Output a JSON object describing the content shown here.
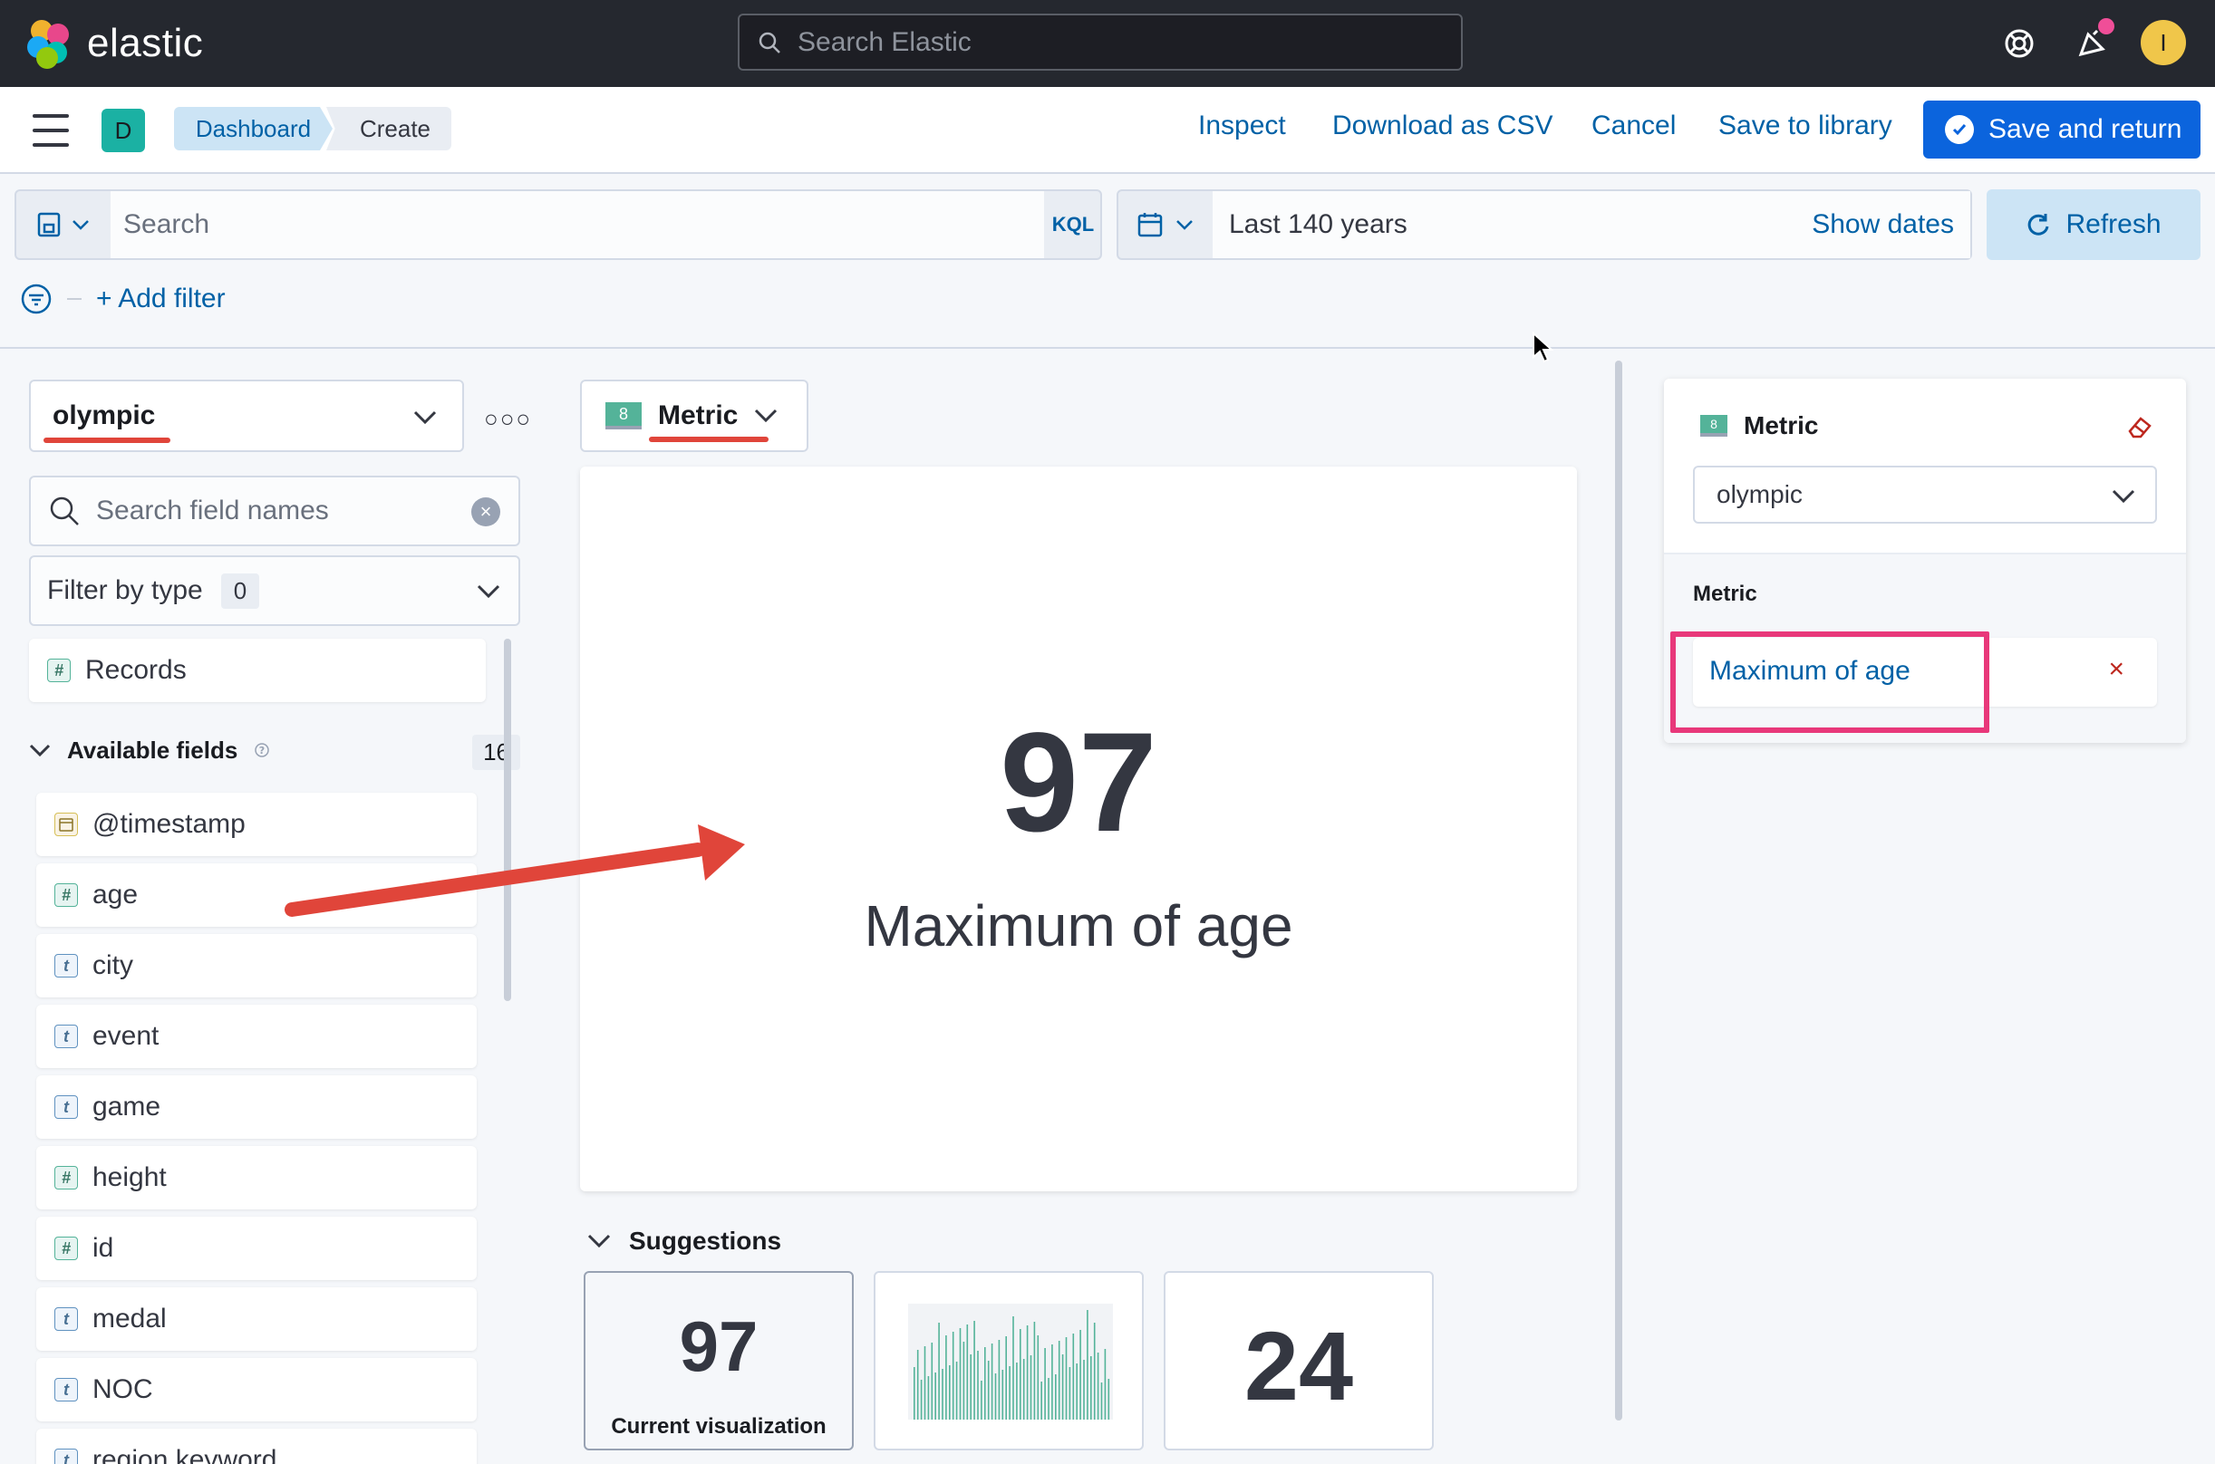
{
  "header": {
    "logo_text": "elastic",
    "search_placeholder": "Search Elastic",
    "avatar_initial": "I"
  },
  "appbar": {
    "space_initial": "D",
    "breadcrumbs": [
      "Dashboard",
      "Create"
    ],
    "actions": {
      "inspect": "Inspect",
      "download_csv": "Download as CSV",
      "cancel": "Cancel",
      "save_to_library": "Save to library",
      "save_and_return": "Save and return"
    }
  },
  "query_bar": {
    "search_placeholder": "Search",
    "language": "KQL",
    "time_range": "Last 140 years",
    "show_dates": "Show dates",
    "refresh": "Refresh",
    "add_filter": "+ Add filter"
  },
  "field_list": {
    "data_view": "olympic",
    "search_placeholder": "Search field names",
    "filter_by_type": "Filter by type",
    "filter_count": "0",
    "records_label": "Records",
    "available_fields_label": "Available fields",
    "available_fields_count": "16",
    "fields": [
      {
        "name": "@timestamp",
        "type": "date",
        "token": "date-icon"
      },
      {
        "name": "age",
        "type": "number",
        "token": "#"
      },
      {
        "name": "city",
        "type": "string",
        "token": "t"
      },
      {
        "name": "event",
        "type": "string",
        "token": "t"
      },
      {
        "name": "game",
        "type": "string",
        "token": "t"
      },
      {
        "name": "height",
        "type": "number",
        "token": "#"
      },
      {
        "name": "id",
        "type": "number",
        "token": "#"
      },
      {
        "name": "medal",
        "type": "string",
        "token": "t"
      },
      {
        "name": "NOC",
        "type": "string",
        "token": "t"
      },
      {
        "name": "region.keyword",
        "type": "string",
        "token": "t"
      }
    ]
  },
  "workspace": {
    "chart_type": "Metric",
    "metric_value": "97",
    "metric_label": "Maximum of age",
    "suggestions_title": "Suggestions",
    "suggestions": [
      {
        "value": "97",
        "caption": "Current visualization"
      },
      {
        "value": "",
        "caption": "",
        "kind": "bar-chart-thumbnail"
      },
      {
        "value": "24",
        "caption": ""
      }
    ]
  },
  "config_panel": {
    "title": "Metric",
    "data_view": "olympic",
    "section_label": "Metric",
    "dimension": "Maximum of age"
  },
  "colors": {
    "primary": "#0b64dd",
    "link": "#0061a6",
    "annotation_red": "#e0453a",
    "annotation_pink": "#e8387a"
  }
}
